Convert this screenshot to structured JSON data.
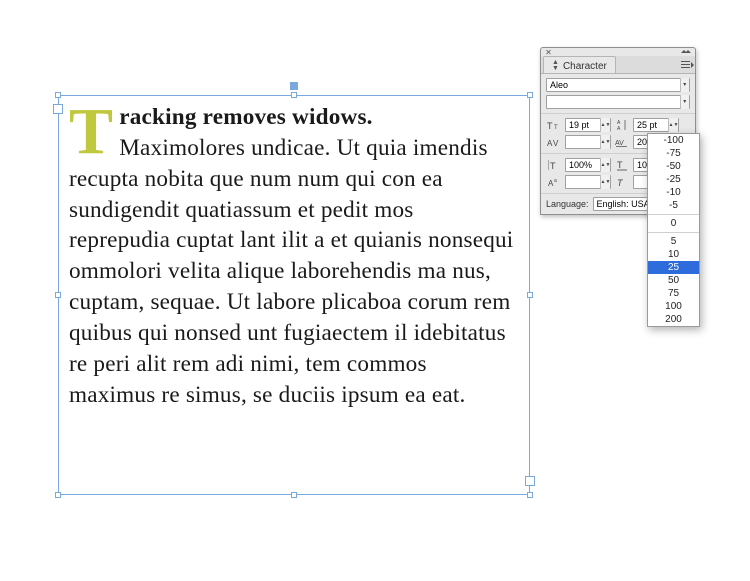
{
  "text_frame": {
    "dropcap": "T",
    "lead": "racking removes widows.",
    "after_lead_line1": "Maximolores undicae. Ut quia",
    "body": "imendis recupta nobita que num num qui con ea sundigendit quatiassum et pedit mos reprepudia cuptat lant ilit a et quianis nonsequi ommolori velita alique laborehendis ma nus, cuptam, sequae. Ut labore plicaboa corum rem quibus qui nonsed unt fugiaectem il idebitatus re peri alit rem adi nimi, tem commos maximus re simus, se duciis ipsum ea eat."
  },
  "panel": {
    "title": "Character",
    "font_family": "Aleo",
    "font_style": "",
    "font_size": "19 pt",
    "leading": "25 pt",
    "kerning": "",
    "tracking": "20",
    "vscale": "100%",
    "hscale": "100%",
    "baseline_shift": "",
    "skew": "",
    "language_label": "Language:",
    "language_value": "English: USA"
  },
  "tracking_dropdown": {
    "negative": [
      "-100",
      "-75",
      "-50",
      "-25",
      "-10",
      "-5"
    ],
    "zero": "0",
    "positive": [
      "5",
      "10",
      "25",
      "50",
      "75",
      "100",
      "200"
    ],
    "selected": "25"
  }
}
